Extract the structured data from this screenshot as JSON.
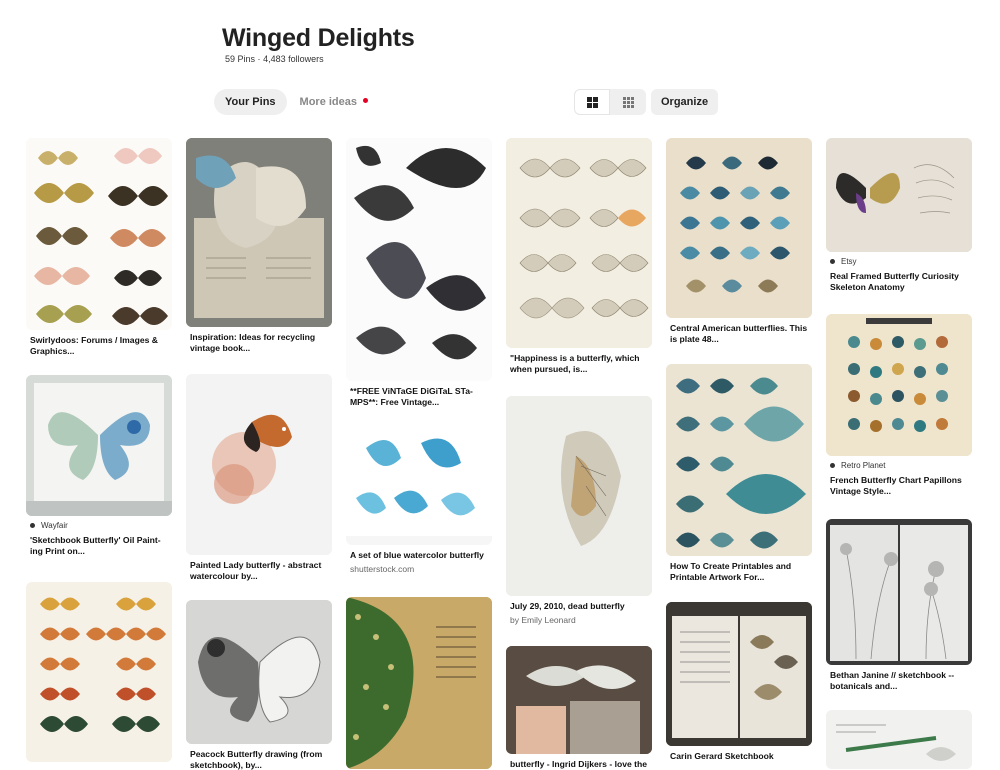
{
  "board": {
    "title": "Winged Delights",
    "pins_count": "59 Pins",
    "separator": "·",
    "followers": "4,483 followers"
  },
  "tabs": {
    "your_pins": "Your Pins",
    "more_ideas": "More ideas"
  },
  "toolbar": {
    "organize": "Organize"
  },
  "colors": {
    "accent": "#e60023",
    "chip_bg": "#efefef"
  },
  "pins": {
    "c1": [
      {
        "title": "Swirlydoos: Forums / Images & Graphics..."
      },
      {
        "attribution": "Wayfair",
        "title": "'Sketchbook Butterfly' Oil Paint-ing Print on..."
      },
      {
        "title": ""
      }
    ],
    "c2": [
      {
        "title": "Inspiration: Ideas for recycling vintage book..."
      },
      {
        "title": "Painted Lady butterfly - abstract watercolour by..."
      },
      {
        "title": "Peacock Butterfly drawing (from sketchbook), by..."
      }
    ],
    "c3": [
      {
        "title": "**FREE ViNTaGE DiGiTaL STa-MPS**: Free Vintage..."
      },
      {
        "title": "A set of blue watercolor butterfly",
        "source": "shutterstock.com"
      },
      {
        "title": ""
      }
    ],
    "c4": [
      {
        "title": "\"Happiness is a butterfly, which when pursued, is..."
      },
      {
        "title": "July 29, 2010, dead butterfly",
        "source": "by Emily Leonard"
      },
      {
        "title": "butterfly - Ingrid Dijkers - love the"
      }
    ],
    "c5": [
      {
        "title": "Central American butterflies. This is plate 48..."
      },
      {
        "title": "How To Create Printables and Printable Artwork For..."
      },
      {
        "title": "Carin Gerard Sketchbook"
      }
    ],
    "c6": [
      {
        "attribution": "Etsy",
        "title": "Real Framed Butterfly Curiosity Skeleton Anatomy"
      },
      {
        "attribution": "Retro Planet",
        "title": "French Butterfly Chart Papillons Vintage Style..."
      },
      {
        "title": "Bethan Janine // sketchbook -- botanicals and..."
      },
      {
        "title": ""
      }
    ]
  }
}
